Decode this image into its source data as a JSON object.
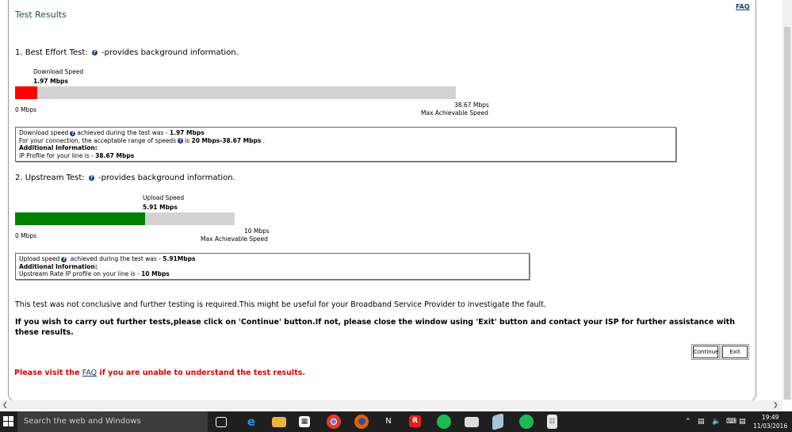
{
  "header": {
    "title": "Test Results",
    "faq_link": "FAQ"
  },
  "best_effort": {
    "heading_prefix": "1. Best Effort Test:",
    "heading_suffix": "-provides background information.",
    "bar_caption": "Download Speed",
    "bar_value": "1.97 Mbps",
    "min_label": "0 Mbps",
    "max_label": "38.67 Mbps",
    "max_caption": "Max Achievable Speed",
    "fill_fraction": 0.051,
    "fill_color": "#ff0000",
    "info_line1_a": "Download speed",
    "info_line1_b": "achieved during the test was - ",
    "info_line1_val": "1.97 Mbps",
    "info_line2_a": "For your connection, the acceptable range of speeds",
    "info_line2_b": "is ",
    "info_line2_val": "20 Mbps-38.67 Mbps",
    "info_line2_end": " .",
    "info_line3": "Additional Information:",
    "info_line4_a": "IP Profile for your line is - ",
    "info_line4_val": "38.67 Mbps"
  },
  "upstream": {
    "heading_prefix": "2. Upstream Test:",
    "heading_suffix": "-provides background information.",
    "bar_caption": "Upload Speed",
    "bar_value": "5.91 Mbps",
    "min_label": "0 Mbps",
    "max_label": "10 Mbps",
    "max_caption": "Max Achievable Speed",
    "fill_fraction": 0.591,
    "fill_color": "#008000",
    "info_line1_a": "Upload speed",
    "info_line1_b": " achieved during the test was - ",
    "info_line1_val": "5.91Mbps",
    "info_line2": "Additional Information:",
    "info_line3_a": "Upstream Rate IP profile on your line is - ",
    "info_line3_val": "10 Mbps"
  },
  "conclusion": "This test was not conclusive and further testing is required.This might be useful for your Broadband Service Provider to investigate the fault.",
  "instruction": "If you wish to carry out further tests,please click on 'Continue' button.If not, please close the window using 'Exit' button and contact your ISP for further assistance with these results.",
  "buttons": {
    "continue": "Continue",
    "exit": "Exit"
  },
  "footer_note": {
    "before": "Please visit the ",
    "link": "FAQ",
    "after": " if you are unable to understand the test results."
  },
  "taskbar": {
    "search_placeholder": "Search the web and Windows",
    "time": "19:49",
    "date": "11/03/2016",
    "icons": [
      "task-view-icon",
      "edge-icon",
      "file-explorer-icon",
      "store-icon",
      "chrome-icon",
      "firefox-icon",
      "network-app-icon",
      "r-app-icon",
      "spotify-icon",
      "media-icon",
      "app-icon",
      "spotify-icon",
      "calculator-icon"
    ]
  },
  "colors": {
    "title": "#1f4f4f",
    "link": "#1b3f6b",
    "warning": "#e00000",
    "help_icon": "#1e3c8c"
  }
}
